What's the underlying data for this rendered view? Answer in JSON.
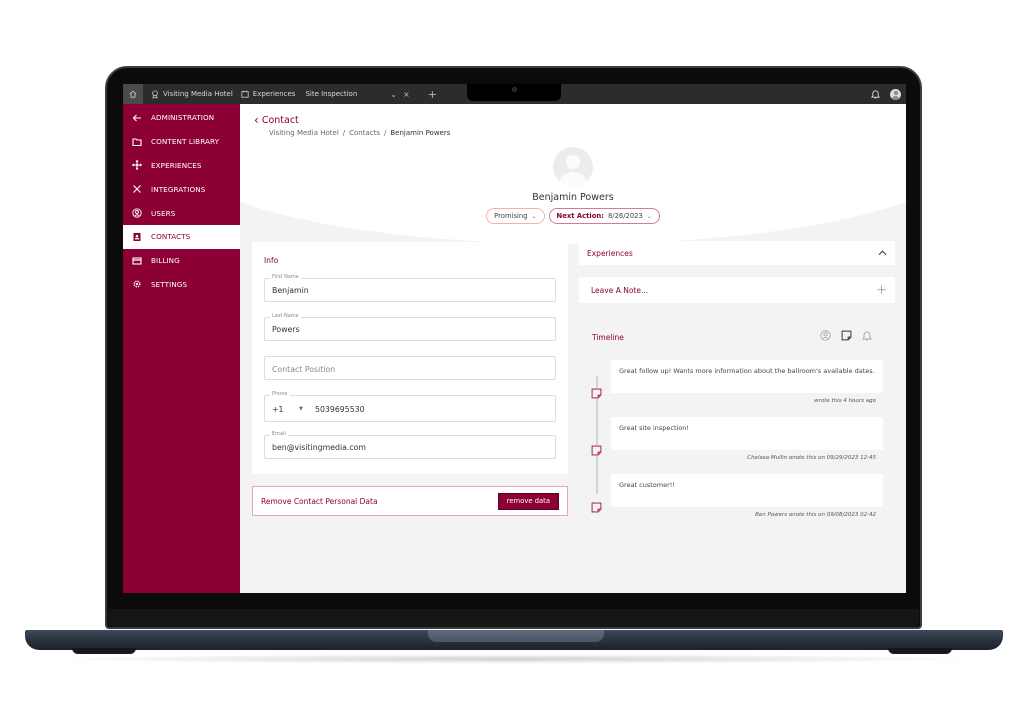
{
  "topbar": {
    "home_icon": "home-icon",
    "tabs": [
      {
        "icon": "award-icon",
        "label": "Visiting Media Hotel"
      },
      {
        "icon": "calendar-icon",
        "label": "Experiences"
      },
      {
        "icon": "",
        "label": "Site Inspection"
      }
    ],
    "dropdown_glyph": "⌄",
    "close_glyph": "×",
    "add_tab_glyph": "+",
    "bell_icon": "bell-icon",
    "avatar_icon": "user-avatar-icon"
  },
  "sidebar": {
    "items": [
      {
        "icon": "arrow-left-icon",
        "label": "ADMINISTRATION",
        "active": false
      },
      {
        "icon": "folder-icon",
        "label": "CONTENT LIBRARY",
        "active": false
      },
      {
        "icon": "experiences-icon",
        "label": "EXPERIENCES",
        "active": false
      },
      {
        "icon": "integrations-icon",
        "label": "INTEGRATIONS",
        "active": false
      },
      {
        "icon": "user-circle-icon",
        "label": "USERS",
        "active": false
      },
      {
        "icon": "contact-card-icon",
        "label": "CONTACTS",
        "active": true
      },
      {
        "icon": "credit-card-icon",
        "label": "BILLING",
        "active": false
      },
      {
        "icon": "gear-icon",
        "label": "SETTINGS",
        "active": false
      }
    ]
  },
  "header": {
    "back_glyph": "‹",
    "back_label": "Contact",
    "breadcrumb": [
      "Visiting Media Hotel",
      "Contacts",
      "Benjamin Powers"
    ],
    "separator": "/",
    "contact_name": "Benjamin Powers",
    "status_pill": "Promising",
    "next_action_label": "Next Action:",
    "next_action_value": "8/26/2023",
    "chevron": "⌄"
  },
  "info": {
    "title": "Info",
    "first_name": {
      "label": "First Name",
      "value": "Benjamin"
    },
    "last_name": {
      "label": "Last Name",
      "value": "Powers"
    },
    "position": {
      "placeholder": "Contact Position",
      "value": ""
    },
    "phone": {
      "label": "Phone",
      "country_code": "+1",
      "value": "5039695530"
    },
    "email": {
      "label": "Email",
      "value": "ben@visitingmedia.com"
    }
  },
  "remove": {
    "text": "Remove Contact Personal Data",
    "button": "remove data"
  },
  "experiences": {
    "title": "Experiences",
    "toggle_glyph": "⌃"
  },
  "leave_note": {
    "title": "Leave A Note...",
    "add_glyph": "+"
  },
  "timeline": {
    "title": "Timeline",
    "filters": [
      "user-filter-icon",
      "note-filter-icon",
      "bell-filter-icon"
    ],
    "entries": [
      {
        "text": "Great follow up! Wants more information about the ballroom's available dates.",
        "meta": "wrote this 4 hours ago"
      },
      {
        "text": "Great site inspection!",
        "meta": "Chelsea Mullin wrote this on 09/29/2023 12:45"
      },
      {
        "text": "Great customer!!",
        "meta": "Ben Powers wrote this on 09/08/2023 02:42"
      }
    ]
  },
  "colors": {
    "brand": "#8d0036",
    "topbar": "#2c2c2c",
    "background": "#f3f3f3"
  }
}
